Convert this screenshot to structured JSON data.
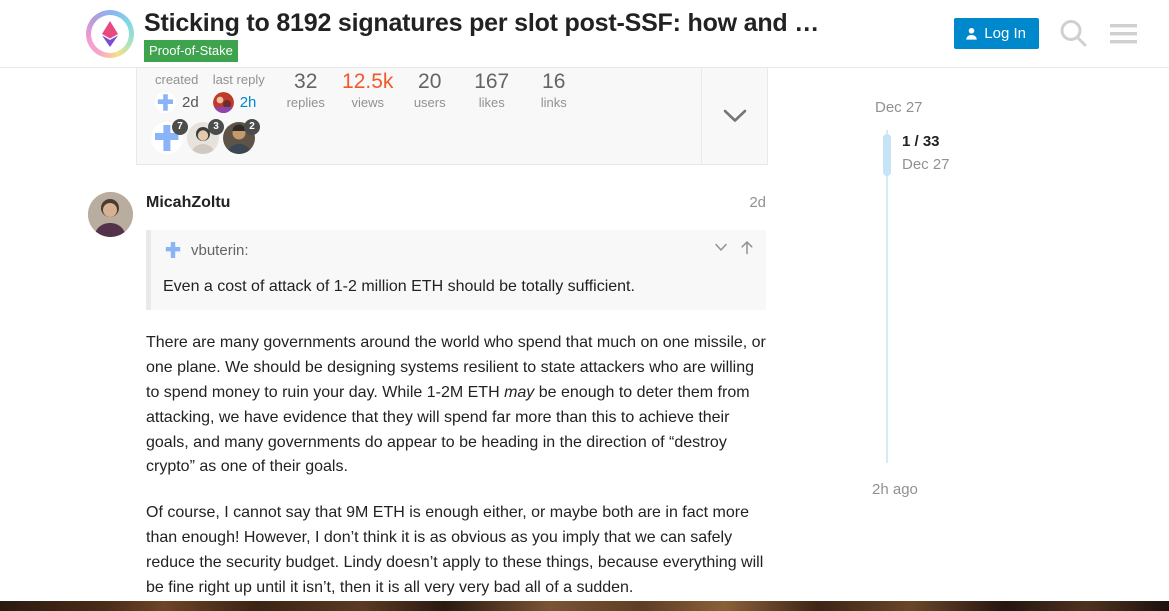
{
  "header": {
    "logo_alt": "ethereum-research-logo",
    "topic_title": "Sticking to 8192 signatures per slot post-SSF: how and …",
    "category": "Proof-of-Stake",
    "category_color": "#3DA34D",
    "login_label": "Log In",
    "search_label": "search-icon",
    "menu_label": "hamburger-icon",
    "accent_color": "#0088cc"
  },
  "topic_map": {
    "created_label": "created",
    "created_value": "2d",
    "last_reply_label": "last reply",
    "last_reply_value": "2h",
    "stats": [
      {
        "num": "32",
        "label": "replies",
        "hot": false
      },
      {
        "num": "12.5k",
        "label": "views",
        "hot": true
      },
      {
        "num": "20",
        "label": "users",
        "hot": false
      },
      {
        "num": "167",
        "label": "likes",
        "hot": false
      },
      {
        "num": "16",
        "label": "links",
        "hot": false
      }
    ],
    "participants": [
      {
        "name": "vbuterin",
        "count": "7"
      },
      {
        "name": "participant-2",
        "count": "3"
      },
      {
        "name": "participant-3",
        "count": "2"
      }
    ],
    "expand_icon": "chevron-down-icon"
  },
  "post": {
    "author": "MicahZoltu",
    "time": "2d",
    "quote": {
      "author": "vbuterin:",
      "text": "Even a cost of attack of 1-2 million ETH should be totally sufficient.",
      "collapse_icon": "chevron-down-icon",
      "jump_icon": "arrow-up-icon"
    },
    "paragraph_1_a": "There are many governments around the world who spend that much on one missile, or one plane. We should be designing systems resilient to state attackers who are willing to spend money to ruin your day. While 1-2M ETH ",
    "paragraph_1_em": "may",
    "paragraph_1_b": " be enough to deter them from attacking, we have evidence that they will spend far more than this to achieve their goals, and many governments do appear to be heading in the direction of “destroy crypto” as one of their goals.",
    "paragraph_2": "Of course, I cannot say that 9M ETH is enough either, or maybe both are in fact more than enough! However, I don’t think it is as obvious as you imply that we can safely reduce the security budget. Lindy doesn’t apply to these things, because everything will be fine right up until it isn’t, then it is all very very bad all of a sudden."
  },
  "timeline": {
    "top_date": "Dec 27",
    "position": "1 / 33",
    "position_date": "Dec 27",
    "last_activity": "2h ago"
  }
}
